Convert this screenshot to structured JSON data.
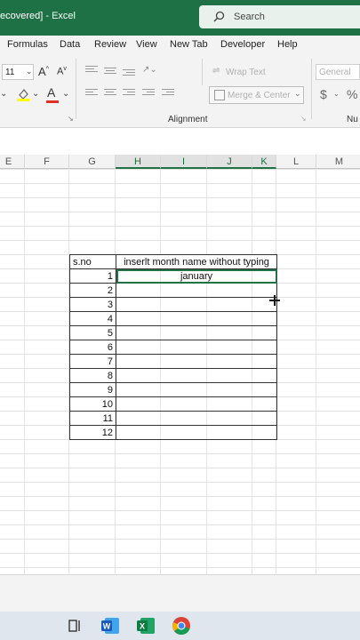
{
  "titlebar": {
    "title": "ecovered]  -  Excel",
    "search_placeholder": "Search",
    "colors": {
      "bar": "#1e7145"
    }
  },
  "menu": {
    "items": [
      "Formulas",
      "Data",
      "Review",
      "View",
      "New Tab",
      "Developer",
      "Help"
    ]
  },
  "ribbon": {
    "font_size": "11",
    "grow_font": "A",
    "shrink_font": "A",
    "font_color": "A",
    "wrap_text": "Wrap Text",
    "merge_center": "Merge & Center",
    "number_format": "General",
    "currency": "$",
    "percent": "%",
    "group_alignment": "Alignment",
    "group_number": "Nu"
  },
  "columns": [
    "E",
    "F",
    "G",
    "H",
    "I",
    "J",
    "K",
    "L",
    "M"
  ],
  "sheet": {
    "headers": [
      "s.no",
      "inserlt month name without typing"
    ],
    "rows": [
      {
        "n": "1",
        "month": "january"
      },
      {
        "n": "2",
        "month": ""
      },
      {
        "n": "3",
        "month": ""
      },
      {
        "n": "4",
        "month": ""
      },
      {
        "n": "5",
        "month": ""
      },
      {
        "n": "6",
        "month": ""
      },
      {
        "n": "7",
        "month": ""
      },
      {
        "n": "8",
        "month": ""
      },
      {
        "n": "9",
        "month": ""
      },
      {
        "n": "10",
        "month": ""
      },
      {
        "n": "11",
        "month": ""
      },
      {
        "n": "12",
        "month": ""
      }
    ]
  },
  "taskbar": {
    "icons": [
      "task-view-icon",
      "word-icon",
      "excel-icon",
      "chrome-icon"
    ]
  }
}
